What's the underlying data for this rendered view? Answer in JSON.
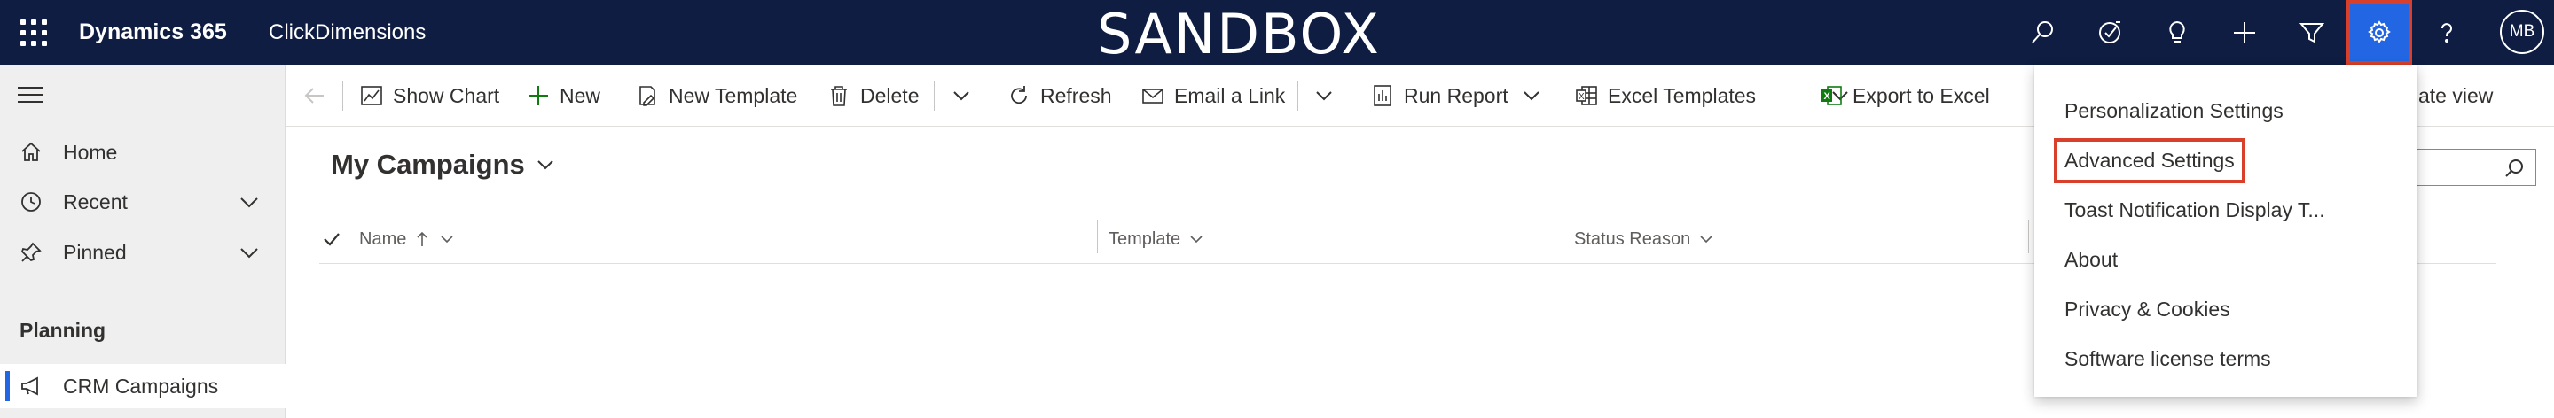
{
  "topbar": {
    "brand": "Dynamics 365",
    "app_name": "ClickDimensions",
    "environment": "SANDBOX",
    "icons": [
      "search-icon",
      "task-icon",
      "lightbulb-icon",
      "plus-icon",
      "filter-icon",
      "gear-icon",
      "help-icon"
    ],
    "user_initials": "MB"
  },
  "sidebar": {
    "items": [
      {
        "label": "Home",
        "icon": "home-icon"
      },
      {
        "label": "Recent",
        "icon": "clock-icon"
      },
      {
        "label": "Pinned",
        "icon": "pin-icon"
      }
    ],
    "group_title": "Planning",
    "group_items": [
      {
        "label": "CRM Campaigns",
        "icon": "megaphone-icon",
        "selected": true
      }
    ]
  },
  "commandbar": {
    "items": [
      {
        "label": "Show Chart",
        "icon": "chart-icon"
      },
      {
        "label": "New",
        "icon": "plus-icon"
      },
      {
        "label": "New Template",
        "icon": "template-icon"
      },
      {
        "label": "Delete",
        "icon": "trash-icon"
      },
      {
        "label": "Refresh",
        "icon": "refresh-icon"
      },
      {
        "label": "Email a Link",
        "icon": "email-icon"
      },
      {
        "label": "Run Report",
        "icon": "report-icon"
      },
      {
        "label": "Excel Templates",
        "icon": "excel-template-icon"
      },
      {
        "label": "Export to Excel",
        "icon": "excel-icon"
      }
    ],
    "partial_right_label": "ate view"
  },
  "view": {
    "title": "My Campaigns"
  },
  "grid": {
    "columns": [
      {
        "label": "Name",
        "sort": "ascending"
      },
      {
        "label": "Template"
      },
      {
        "label": "Status Reason"
      }
    ]
  },
  "settings_menu": {
    "items": [
      {
        "label": "Personalization Settings"
      },
      {
        "label": "Advanced Settings",
        "highlighted": true
      },
      {
        "label": "Toast Notification Display T..."
      },
      {
        "label": "About"
      },
      {
        "label": "Privacy & Cookies"
      },
      {
        "label": "Software license terms"
      }
    ]
  },
  "colors": {
    "topbar_bg": "#0f1d42",
    "active_icon_bg": "#2266e3",
    "highlight_border": "#d9402b",
    "sidebar_bg": "#efefef"
  }
}
